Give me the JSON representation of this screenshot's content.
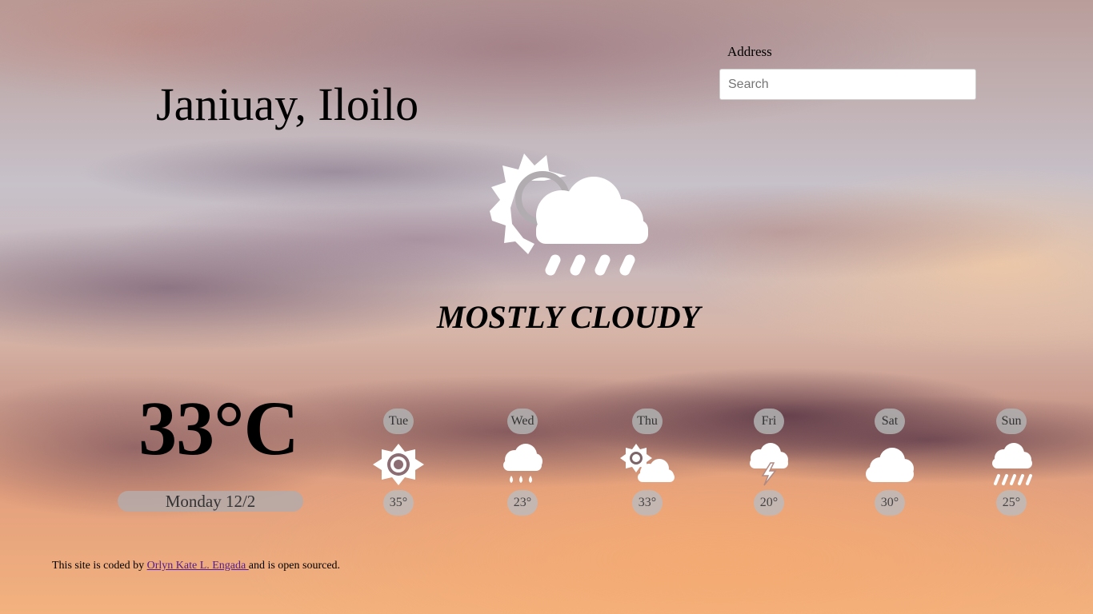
{
  "location": {
    "city": "Janiuay, Iloilo"
  },
  "search": {
    "label": "Address",
    "placeholder": "Search",
    "value": ""
  },
  "current": {
    "icon": "partly-cloudy-rain-icon",
    "condition": "MOSTLY CLOUDY",
    "temperature": "33°C",
    "date": "Monday 12/2"
  },
  "forecast": [
    {
      "day": "Tue",
      "icon": "sun-icon",
      "temp": "35°"
    },
    {
      "day": "Wed",
      "icon": "rain-icon",
      "temp": "23°"
    },
    {
      "day": "Thu",
      "icon": "partly-cloudy-icon",
      "temp": "33°"
    },
    {
      "day": "Fri",
      "icon": "thunderstorm-icon",
      "temp": "20°"
    },
    {
      "day": "Sat",
      "icon": "cloud-icon",
      "temp": "30°"
    },
    {
      "day": "Sun",
      "icon": "heavy-rain-icon",
      "temp": "25°"
    }
  ],
  "footer": {
    "prefix": "This site is coded by ",
    "author": "Orlyn Kate L. Engada ",
    "suffix": "and is open sourced."
  },
  "colors": {
    "icon": "#ffffff",
    "pill_background": "#afafaf",
    "link": "#551a8b"
  }
}
